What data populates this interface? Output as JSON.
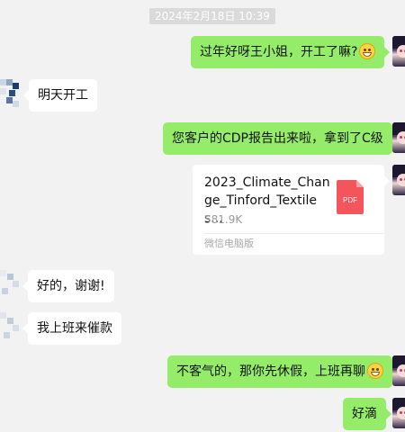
{
  "chat": {
    "timestamp": "2024年2月18日 10:39",
    "messages": [
      {
        "side": "out",
        "text": "过年好呀王小姐，开工了嘛?",
        "emoji": "grin-emoji"
      },
      {
        "side": "in",
        "text": "明天开工"
      },
      {
        "side": "out",
        "text": "您客户的CDP报告出来啦，拿到了C级"
      },
      {
        "side": "in",
        "text": "好的，谢谢!"
      },
      {
        "side": "in",
        "text": "我上班来催款"
      },
      {
        "side": "out",
        "text": "不客气的，那你先休假，上班再聊",
        "emoji": "smile-emoji"
      },
      {
        "side": "out",
        "text": "好滴"
      }
    ],
    "file": {
      "name": "2023_Climate_Change_Tinford_Textiles...",
      "size": "581.9K",
      "type_label": "PDF",
      "source": "微信电脑版",
      "icon": "pdf-file-icon"
    }
  },
  "colors": {
    "background": "#f2f2f2",
    "outgoing_bubble": "#95ec69",
    "incoming_bubble": "#ffffff",
    "pdf_red": "#f4545b"
  }
}
